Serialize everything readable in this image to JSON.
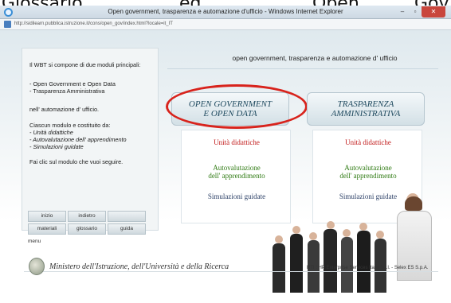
{
  "cut_text": [
    "Glossario",
    "ed",
    "Open",
    "Gov"
  ],
  "window": {
    "title": "Open government, trasparenza e automazione d'ufficio - Windows Internet Explorer",
    "minimize": "–",
    "maximize": "▫",
    "close": "✕",
    "url": "http://sidilearn.pubblica.istruzione.it/cons/open_gov/index.html?locale=it_IT"
  },
  "intro": {
    "p1": "Il WBT si compone di due moduli principali:",
    "p2a": "- Open Government e Open Data",
    "p2b": "- Trasparenza Amministrativa",
    "p3": "nell' automazione d' ufficio.",
    "p4": "Ciascun modulo e costituito da:",
    "li1": "- Unità didattiche",
    "li2": "- Autovalutazione dell' apprendimento",
    "li3": "- Simulazioni guidate",
    "cta": "Fai clic sul modulo che vuoi seguire."
  },
  "header_text": "open government, trasparenza e automazione d' ufficio",
  "modules": [
    {
      "title_line1": "OPEN GOVERNMENT",
      "title_line2": "E OPEN DATA",
      "link_units": "Unità didattiche",
      "link_self1": "Autovalutazione",
      "link_self2": "dell' apprendimento",
      "link_sims": "Simulazioni guidate"
    },
    {
      "title_line1": "TRASPARENZA",
      "title_line2": "AMMINISTRATIVA",
      "link_units": "Unità didattiche",
      "link_self1": "Autovalutazione",
      "link_self2": "dell' apprendimento",
      "link_sims": "Simulazioni guidate"
    }
  ],
  "nav": {
    "inizio": "inizio",
    "indietro": "indietro",
    "materiali": "materiali",
    "glossario": "glossario",
    "guida": "guida",
    "menu": "menu"
  },
  "footer": {
    "ministry": "Ministero dell'Istruzione, dell'Università e della Ricerca",
    "credit": "RTI : HP Enterprise Services Italia S.r.l. - Selex ES S.p.A."
  },
  "colors": {
    "highlight_oval": "#d8231c",
    "units_link": "#c11a1a",
    "self_eval_link": "#2e7a12",
    "sims_link": "#2b3f66"
  }
}
